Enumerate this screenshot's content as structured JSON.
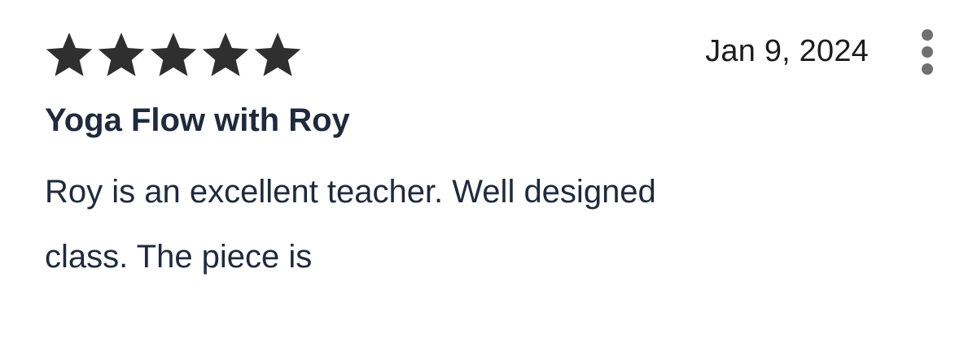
{
  "review": {
    "rating": 5,
    "rating_max": 5,
    "date": "Jan 9, 2024",
    "title": "Yoga Flow with Roy",
    "body_line_1": "Roy is an excellent teacher. Well designed",
    "body_line_2": "class. The piece is"
  },
  "icons": {
    "star": "star-filled-icon",
    "more": "more-vertical-icon"
  },
  "colors": {
    "star": "#2f2f2f",
    "text": "#1f2a3c",
    "more_dots": "#707070"
  }
}
